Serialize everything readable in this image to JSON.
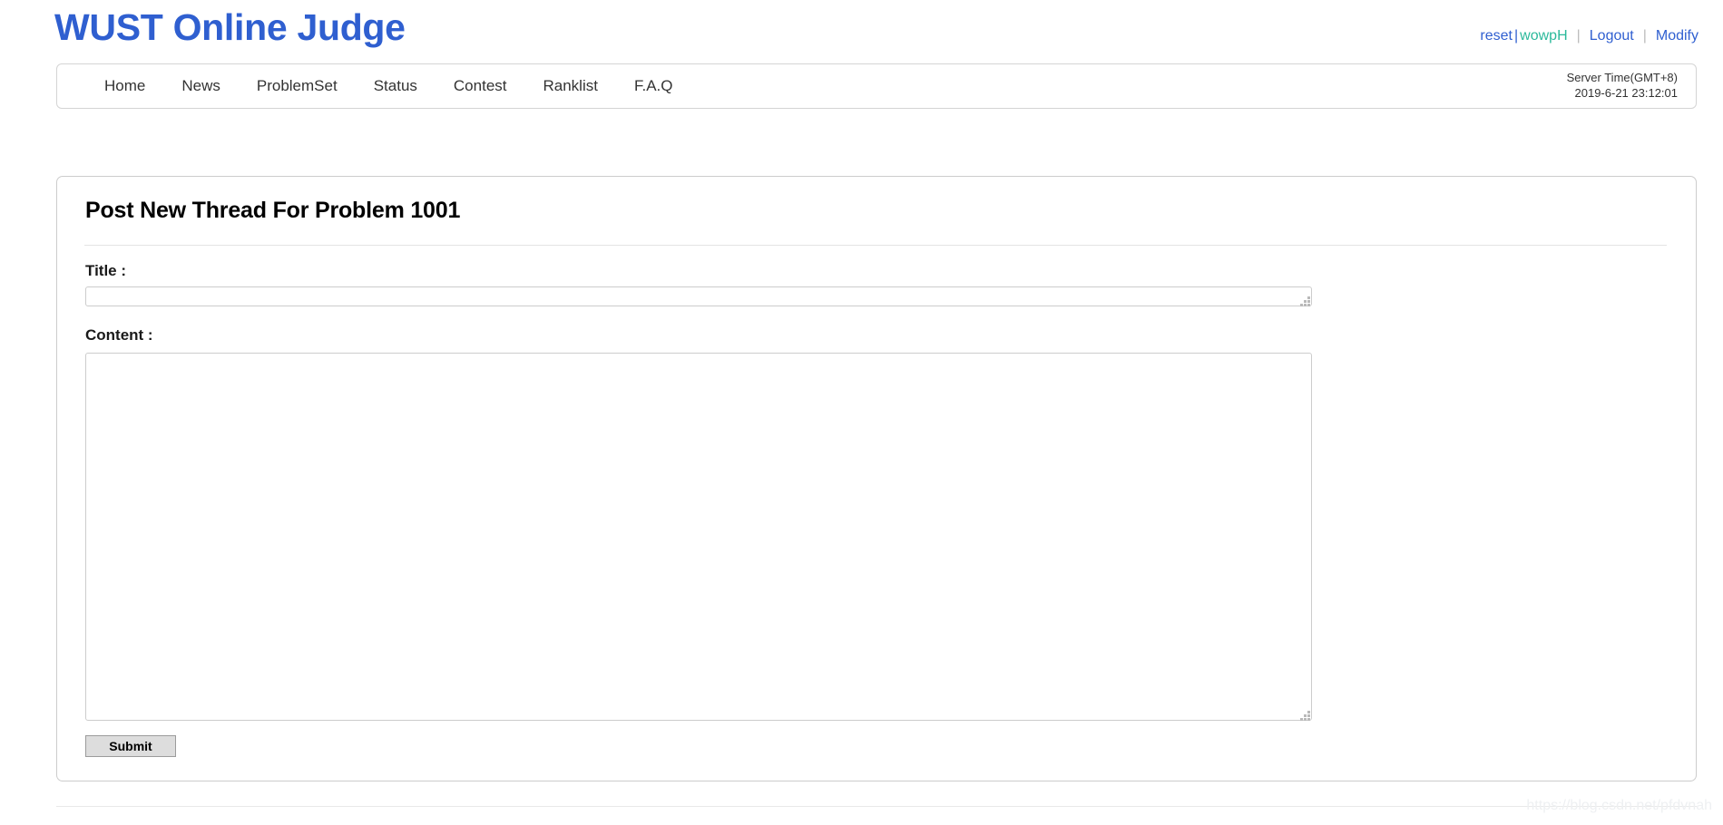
{
  "site": {
    "title": "WUST Online Judge",
    "title_color": "#2f5fd0"
  },
  "topbar": {
    "reset_label": "reset",
    "separator": "|",
    "username": "wowpH",
    "logout_label": "Logout",
    "modify_label": "Modify"
  },
  "nav": {
    "items": [
      {
        "label": "Home"
      },
      {
        "label": "News"
      },
      {
        "label": "ProblemSet"
      },
      {
        "label": "Status"
      },
      {
        "label": "Contest"
      },
      {
        "label": "Ranklist"
      },
      {
        "label": "F.A.Q"
      }
    ],
    "server_time_label": "Server Time(GMT+8)",
    "server_time_value": "2019-6-21 23:12:01"
  },
  "panel": {
    "heading": "Post New Thread For Problem 1001",
    "title_field": {
      "label": "Title :",
      "value": "",
      "placeholder": ""
    },
    "content_field": {
      "label": "Content :",
      "value": "",
      "placeholder": ""
    },
    "submit_label": "Submit"
  },
  "footer": {
    "watermark": "https://blog.csdn.net/pfdvnah"
  }
}
